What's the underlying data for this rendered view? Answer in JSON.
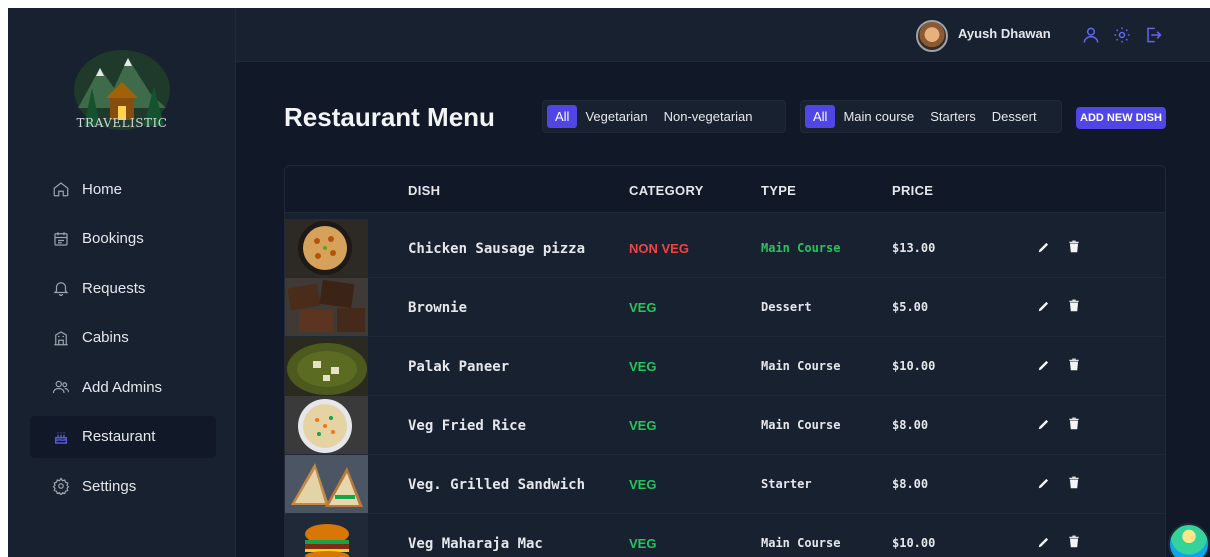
{
  "brand": {
    "name": "TRAVELISTIC"
  },
  "sidebar": {
    "items": [
      {
        "label": "Home",
        "icon": "home-icon"
      },
      {
        "label": "Bookings",
        "icon": "calendar-icon"
      },
      {
        "label": "Requests",
        "icon": "bell-icon"
      },
      {
        "label": "Cabins",
        "icon": "cabin-icon"
      },
      {
        "label": "Add Admins",
        "icon": "users-icon"
      },
      {
        "label": "Restaurant",
        "icon": "cake-icon",
        "active": true
      },
      {
        "label": "Settings",
        "icon": "gear-icon"
      }
    ]
  },
  "header": {
    "user_name": "Ayush Dhawan",
    "icons": [
      "user-icon",
      "sun-icon",
      "logout-icon"
    ]
  },
  "main": {
    "title": "Restaurant Menu",
    "diet_filter": [
      "All",
      "Vegetarian",
      "Non-vegetarian"
    ],
    "course_filter": [
      "All",
      "Main course",
      "Starters",
      "Dessert"
    ],
    "add_button": "ADD NEW DISH",
    "columns": [
      "DISH",
      "CATEGORY",
      "TYPE",
      "PRICE"
    ],
    "rows": [
      {
        "dish": "Chicken Sausage pizza",
        "category": "NON VEG",
        "type": "Main Course",
        "price": "$13.00"
      },
      {
        "dish": "Brownie",
        "category": "VEG",
        "type": "Dessert",
        "price": "$5.00"
      },
      {
        "dish": "Palak Paneer",
        "category": "VEG",
        "type": "Main Course",
        "price": "$10.00"
      },
      {
        "dish": "Veg Fried Rice",
        "category": "VEG",
        "type": "Main Course",
        "price": "$8.00"
      },
      {
        "dish": "Veg. Grilled Sandwich",
        "category": "VEG",
        "type": "Starter",
        "price": "$8.00"
      },
      {
        "dish": "Veg Maharaja Mac",
        "category": "VEG",
        "type": "Main Course",
        "price": "$10.00"
      }
    ]
  },
  "colors": {
    "accent": "#4f46e5",
    "veg": "#22c55e",
    "nonveg": "#ef4444",
    "background": "#111827",
    "panel": "#18212f"
  }
}
